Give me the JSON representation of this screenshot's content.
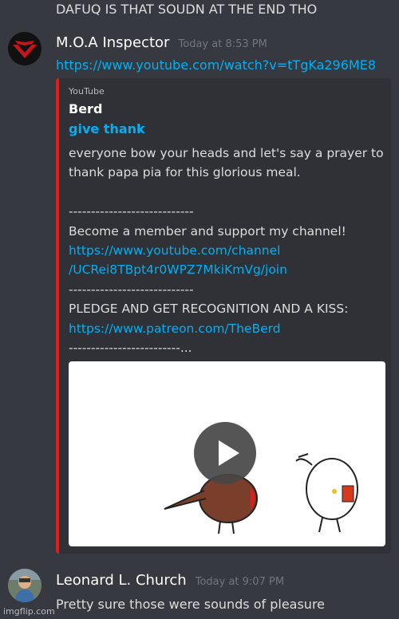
{
  "previous_message": {
    "text": "DAFUQ IS THAT SOUDN AT THE END THO"
  },
  "message1": {
    "username": "M.O.A Inspector",
    "timestamp": "Today at 8:53 PM",
    "link": "https://www.youtube.com/watch?v=tTgKa296ME8",
    "embed": {
      "provider": "YouTube",
      "author": "Berd",
      "title": "give thank",
      "description_lines": [
        "everyone bow your heads and let's say a prayer to",
        "thank papa pia for this glorious meal.",
        "",
        "----------------------------",
        "Become a member and support my channel!",
        "https://www.youtube.com/channel",
        "/UCRei8TBpt4r0WPZ7MkiKmVg/join",
        "----------------------------",
        "PLEDGE AND GET RECOGNITION AND A KISS:",
        "https://www.patreon.com/TheBerd",
        "-------------------------..."
      ],
      "accent_color": "#e91916",
      "play_icon": "play-icon"
    }
  },
  "message2": {
    "username": "Leonard L. Church",
    "timestamp": "Today at 9:07 PM",
    "text": "Pretty sure those were sounds of pleasure"
  },
  "watermark": "imgflip.com",
  "colors": {
    "background": "#36393f",
    "embed_background": "#2f3136",
    "link": "#00b0f4",
    "text": "#dcddde",
    "muted": "#72767d"
  }
}
